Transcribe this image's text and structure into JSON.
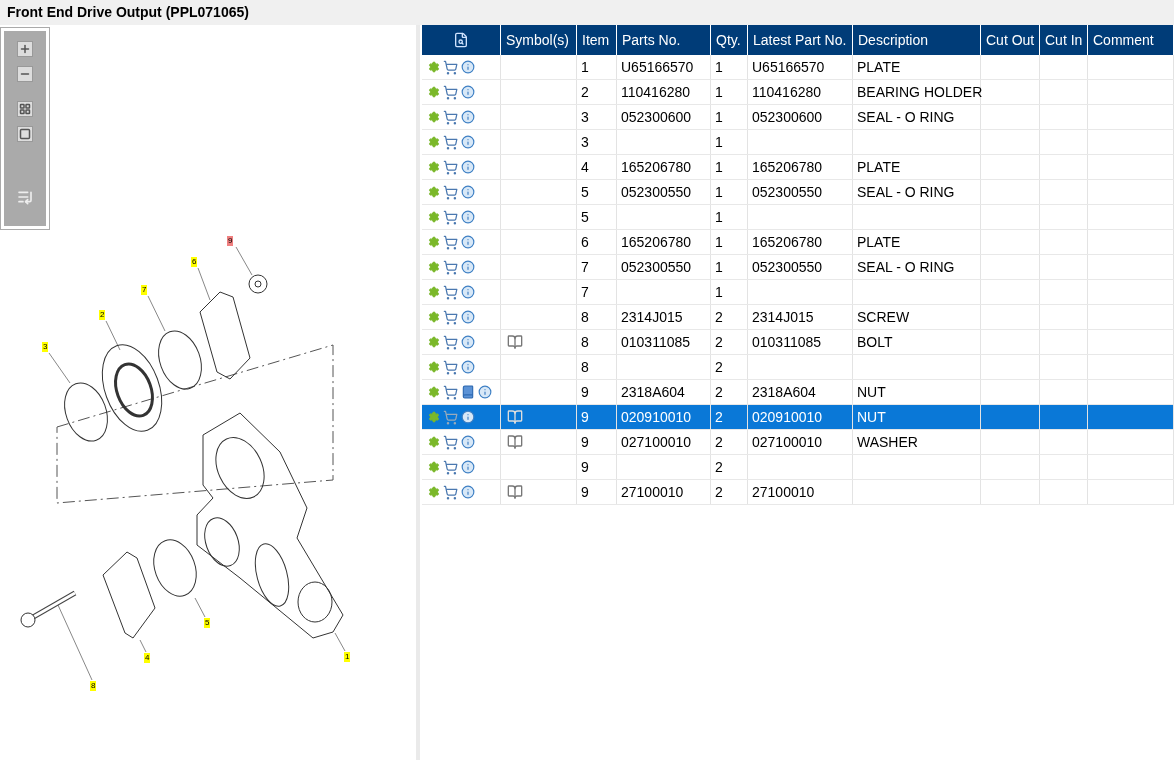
{
  "title": "Front End Drive Output (PPL071065)",
  "callouts": [
    {
      "label": "9",
      "selected": true
    },
    {
      "label": "6",
      "selected": false
    },
    {
      "label": "7",
      "selected": false
    },
    {
      "label": "2",
      "selected": false
    },
    {
      "label": "3",
      "selected": false
    },
    {
      "label": "5",
      "selected": false
    },
    {
      "label": "4",
      "selected": false
    },
    {
      "label": "1",
      "selected": false
    },
    {
      "label": "8",
      "selected": false
    }
  ],
  "table": {
    "columns": [
      "Symbol(s)",
      "Item",
      "Parts No.",
      "Qty.",
      "Latest Part No.",
      "Description",
      "Cut Out",
      "Cut In",
      "Comment"
    ],
    "rows": [
      {
        "manual": false,
        "symbol": false,
        "selected": false,
        "item": "1",
        "parts_no": "U65166570",
        "qty": "1",
        "latest": "U65166570",
        "description": "PLATE"
      },
      {
        "manual": false,
        "symbol": false,
        "selected": false,
        "item": "2",
        "parts_no": "110416280",
        "qty": "1",
        "latest": "110416280",
        "description": "BEARING HOLDER"
      },
      {
        "manual": false,
        "symbol": false,
        "selected": false,
        "item": "3",
        "parts_no": "052300600",
        "qty": "1",
        "latest": "052300600",
        "description": "SEAL - O RING"
      },
      {
        "manual": false,
        "symbol": false,
        "selected": false,
        "item": "3",
        "qty": "1"
      },
      {
        "manual": false,
        "symbol": false,
        "selected": false,
        "item": "4",
        "parts_no": "165206780",
        "qty": "1",
        "latest": "165206780",
        "description": "PLATE"
      },
      {
        "manual": false,
        "symbol": false,
        "selected": false,
        "item": "5",
        "parts_no": "052300550",
        "qty": "1",
        "latest": "052300550",
        "description": "SEAL - O RING"
      },
      {
        "manual": false,
        "symbol": false,
        "selected": false,
        "item": "5",
        "qty": "1"
      },
      {
        "manual": false,
        "symbol": false,
        "selected": false,
        "item": "6",
        "parts_no": "165206780",
        "qty": "1",
        "latest": "165206780",
        "description": "PLATE"
      },
      {
        "manual": false,
        "symbol": false,
        "selected": false,
        "item": "7",
        "parts_no": "052300550",
        "qty": "1",
        "latest": "052300550",
        "description": "SEAL - O RING"
      },
      {
        "manual": false,
        "symbol": false,
        "selected": false,
        "item": "7",
        "qty": "1"
      },
      {
        "manual": false,
        "symbol": false,
        "selected": false,
        "item": "8",
        "parts_no": "2314J015",
        "qty": "2",
        "latest": "2314J015",
        "description": "SCREW"
      },
      {
        "manual": false,
        "symbol": true,
        "selected": false,
        "item": "8",
        "parts_no": "010311085",
        "qty": "2",
        "latest": "010311085",
        "description": "BOLT"
      },
      {
        "manual": false,
        "symbol": false,
        "selected": false,
        "item": "8",
        "qty": "2"
      },
      {
        "manual": true,
        "symbol": false,
        "selected": false,
        "item": "9",
        "parts_no": "2318A604",
        "qty": "2",
        "latest": "2318A604",
        "description": "NUT"
      },
      {
        "manual": false,
        "symbol": true,
        "selected": true,
        "item": "9",
        "parts_no": "020910010",
        "qty": "2",
        "latest": "020910010",
        "description": "NUT"
      },
      {
        "manual": false,
        "symbol": true,
        "selected": false,
        "item": "9",
        "parts_no": "027100010",
        "qty": "2",
        "latest": "027100010",
        "description": "WASHER"
      },
      {
        "manual": false,
        "symbol": false,
        "selected": false,
        "item": "9",
        "qty": "2"
      },
      {
        "manual": false,
        "symbol": true,
        "selected": false,
        "item": "9",
        "parts_no": "27100010",
        "qty": "2",
        "latest": "27100010"
      }
    ]
  }
}
